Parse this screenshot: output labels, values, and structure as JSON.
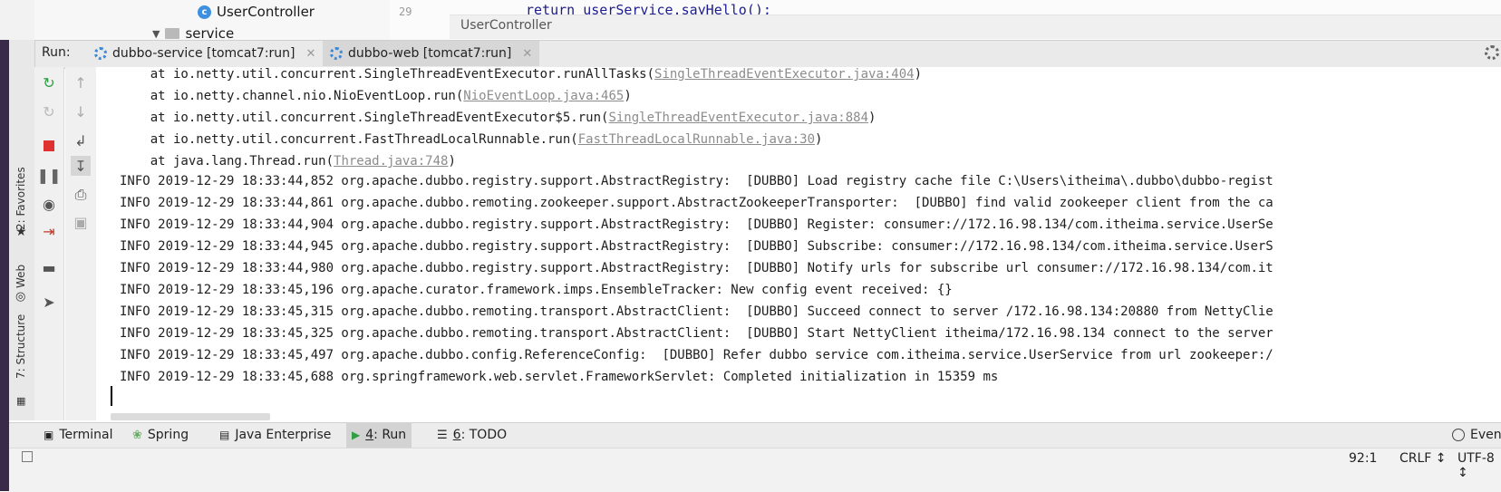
{
  "project_tree": {
    "user_controller": "UserController",
    "service_folder": "service"
  },
  "editor": {
    "line_number": "29",
    "code_peek": "return userService.sayHello();",
    "breadcrumb": "UserController"
  },
  "run_panel": {
    "label": "Run:",
    "tabs": [
      {
        "label": "dubbo-service [tomcat7:run]",
        "icon": "tomcat-gear-icon"
      },
      {
        "label": "dubbo-web [tomcat7:run]",
        "icon": "tomcat-gear-icon"
      }
    ]
  },
  "left_strip": {
    "favorites": "2: Favorites",
    "web": "Web",
    "structure": "7: Structure"
  },
  "console": {
    "lines": [
      {
        "prefix": "    at io.netty.util.concurrent.SingleThreadEventExecutor.runAllTasks(",
        "link": "SingleThreadEventExecutor.java:404",
        "suffix": ")"
      },
      {
        "prefix": "    at io.netty.channel.nio.NioEventLoop.run(",
        "link": "NioEventLoop.java:465",
        "suffix": ")"
      },
      {
        "prefix": "    at io.netty.util.concurrent.SingleThreadEventExecutor$5.run(",
        "link": "SingleThreadEventExecutor.java:884",
        "suffix": ")"
      },
      {
        "prefix": "    at io.netty.util.concurrent.FastThreadLocalRunnable.run(",
        "link": "FastThreadLocalRunnable.java:30",
        "suffix": ")"
      },
      {
        "prefix": "    at java.lang.Thread.run(",
        "link": "Thread.java:748",
        "suffix": ")"
      },
      {
        "prefix": "INFO 2019-12-29 18:33:44,852 org.apache.dubbo.registry.support.AbstractRegistry:  [DUBBO] Load registry cache file C:\\Users\\itheima\\.dubbo\\dubbo-regist",
        "link": "",
        "suffix": ""
      },
      {
        "prefix": "INFO 2019-12-29 18:33:44,861 org.apache.dubbo.remoting.zookeeper.support.AbstractZookeeperTransporter:  [DUBBO] find valid zookeeper client from the ca",
        "link": "",
        "suffix": ""
      },
      {
        "prefix": "INFO 2019-12-29 18:33:44,904 org.apache.dubbo.registry.support.AbstractRegistry:  [DUBBO] Register: consumer://172.16.98.134/com.itheima.service.UserSe",
        "link": "",
        "suffix": ""
      },
      {
        "prefix": "INFO 2019-12-29 18:33:44,945 org.apache.dubbo.registry.support.AbstractRegistry:  [DUBBO] Subscribe: consumer://172.16.98.134/com.itheima.service.UserS",
        "link": "",
        "suffix": ""
      },
      {
        "prefix": "INFO 2019-12-29 18:33:44,980 org.apache.dubbo.registry.support.AbstractRegistry:  [DUBBO] Notify urls for subscribe url consumer://172.16.98.134/com.it",
        "link": "",
        "suffix": ""
      },
      {
        "prefix": "INFO 2019-12-29 18:33:45,196 org.apache.curator.framework.imps.EnsembleTracker: New config event received: {}",
        "link": "",
        "suffix": ""
      },
      {
        "prefix": "INFO 2019-12-29 18:33:45,315 org.apache.dubbo.remoting.transport.AbstractClient:  [DUBBO] Succeed connect to server /172.16.98.134:20880 from NettyClie",
        "link": "",
        "suffix": ""
      },
      {
        "prefix": "INFO 2019-12-29 18:33:45,325 org.apache.dubbo.remoting.transport.AbstractClient:  [DUBBO] Start NettyClient itheima/172.16.98.134 connect to the server",
        "link": "",
        "suffix": ""
      },
      {
        "prefix": "INFO 2019-12-29 18:33:45,497 org.apache.dubbo.config.ReferenceConfig:  [DUBBO] Refer dubbo service com.itheima.service.UserService from url zookeeper:/",
        "link": "",
        "suffix": ""
      },
      {
        "prefix": "INFO 2019-12-29 18:33:45,688 org.springframework.web.servlet.FrameworkServlet: Completed initialization in 15359 ms",
        "link": "",
        "suffix": ""
      }
    ]
  },
  "bottom_tabs": {
    "terminal": "Terminal",
    "spring": "Spring",
    "java_enterprise": "Java Enterprise",
    "run_num": "4",
    "run": ": Run",
    "todo_num": "6",
    "todo": ": TODO",
    "event_log": "Even"
  },
  "status_bar": {
    "position": "92:1",
    "line_sep": "CRLF ↕",
    "encoding": "UTF-8 ↕"
  },
  "colors": {
    "accent": "#3b89d6",
    "link": "#8c8c8c",
    "rerun": "#2f9e44",
    "stop": "#e03131"
  }
}
